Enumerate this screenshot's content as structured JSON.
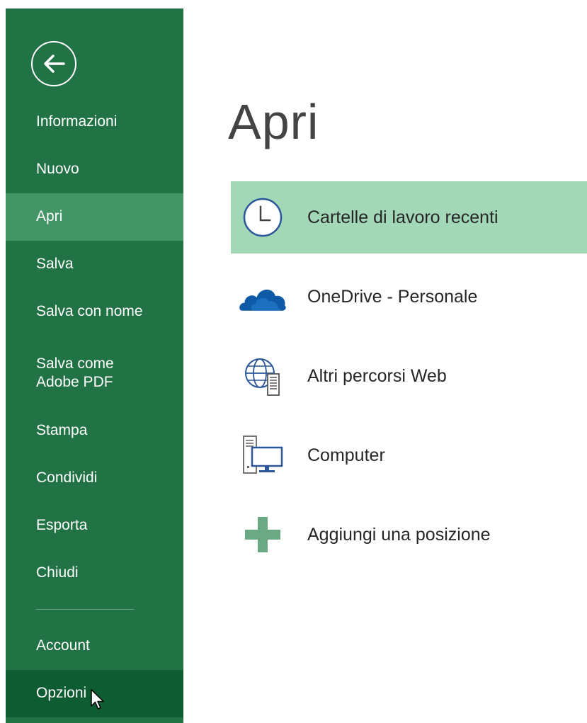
{
  "page": {
    "title": "Apri"
  },
  "sidebar": {
    "items": [
      {
        "label": "Informazioni"
      },
      {
        "label": "Nuovo"
      },
      {
        "label": "Apri"
      },
      {
        "label": "Salva"
      },
      {
        "label": "Salva con nome"
      },
      {
        "label": "Salva come\nAdobe PDF"
      },
      {
        "label": "Stampa"
      },
      {
        "label": "Condividi"
      },
      {
        "label": "Esporta"
      },
      {
        "label": "Chiudi"
      },
      {
        "label": "Account"
      },
      {
        "label": "Opzioni"
      }
    ],
    "active_index": 2,
    "hover_index": 11
  },
  "locations": [
    {
      "label": "Cartelle di lavoro recenti",
      "icon": "clock-icon"
    },
    {
      "label": "OneDrive - Personale",
      "icon": "onedrive-cloud-icon"
    },
    {
      "label": "Altri percorsi Web",
      "icon": "globe-web-icon"
    },
    {
      "label": "Computer",
      "icon": "computer-icon"
    },
    {
      "label": "Aggiungi una posizione",
      "icon": "plus-icon"
    }
  ],
  "colors": {
    "sidebar_bg": "#217346",
    "sidebar_active": "#439467",
    "sidebar_hover": "#0e5c32",
    "selected_location_bg": "#a2d7b8"
  }
}
